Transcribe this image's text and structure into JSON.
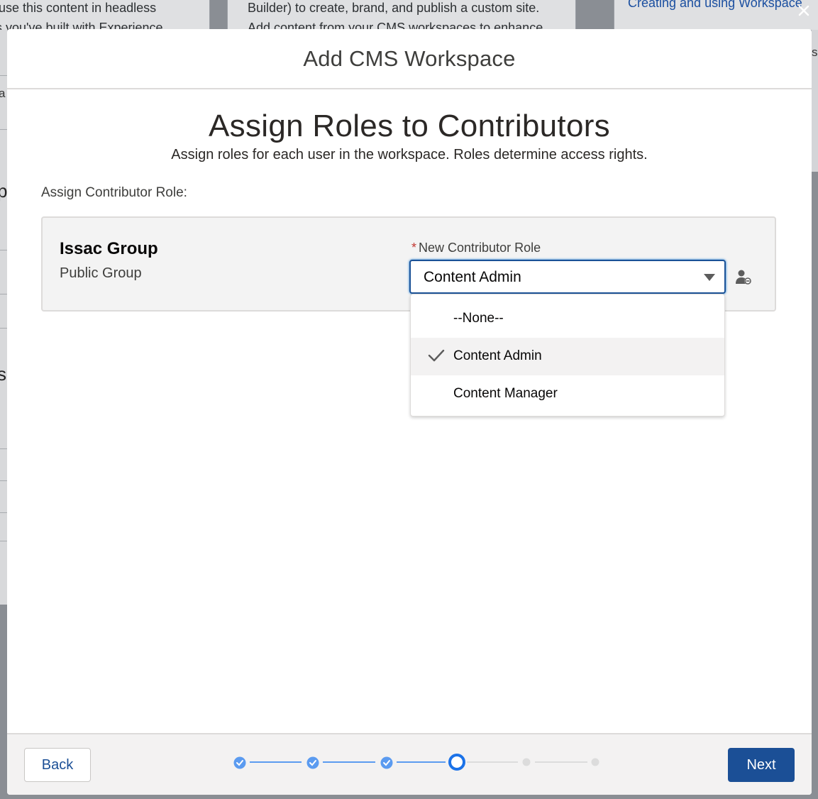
{
  "background": {
    "card1": {
      "line1": "use this content in headless",
      "line2": "s you've built with Experience"
    },
    "card2": {
      "line1": "Builder) to create, brand, and publish a custom site.",
      "line2": "Add content from your CMS workspaces to enhance"
    },
    "card3": {
      "line1": "Creating and using Workspace"
    },
    "left_chars": {
      "a": "a",
      "p": "p",
      "s": "s"
    },
    "right_char": "s"
  },
  "modal": {
    "title": "Add CMS Workspace",
    "close_icon": "close-icon",
    "step_title": "Assign Roles to Contributors",
    "step_subtitle": "Assign roles for each user in the workspace. Roles determine access rights.",
    "assign_label": "Assign Contributor Role:",
    "contributor": {
      "name": "Issac Group",
      "type": "Public Group"
    },
    "role_field": {
      "required_marker": "*",
      "label": "New Contributor Role",
      "value": "Content Admin",
      "options": [
        "--None--",
        "Content Admin",
        "Content Manager"
      ],
      "selected_index": 1
    },
    "footer": {
      "back_label": "Back",
      "next_label": "Next",
      "progress": {
        "total_steps": 6,
        "completed_steps": 3,
        "current_step": 4
      }
    }
  },
  "colors": {
    "brand": "#1b4f96",
    "focus_border": "#1b5297",
    "progress_complete": "#5b9bf0",
    "progress_incomplete": "#dcdcdc",
    "required": "#c23934"
  }
}
